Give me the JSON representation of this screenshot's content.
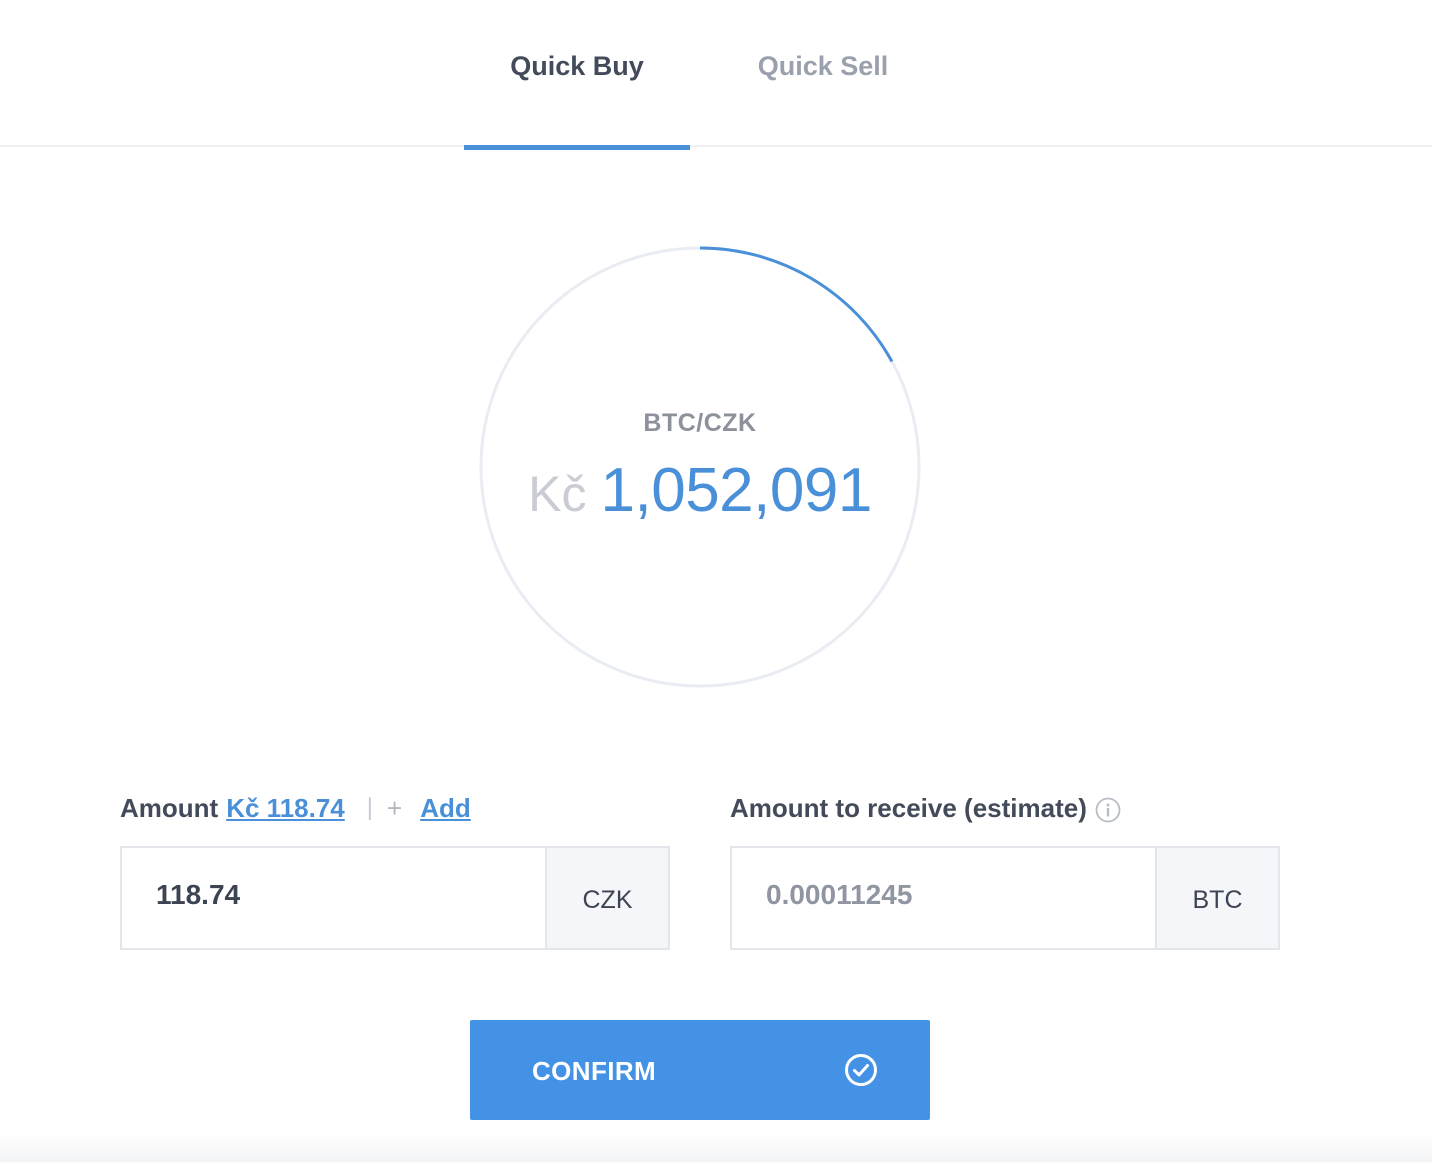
{
  "tabs": [
    {
      "label": "Quick Buy",
      "active": true
    },
    {
      "label": "Quick Sell",
      "active": false
    }
  ],
  "ticker": {
    "pair": "BTC/CZK",
    "currency_symbol": "Kč",
    "price": "1,052,091",
    "progress_fraction": 0.17
  },
  "amount": {
    "label": "Amount",
    "balance_link": "Kč 118.74",
    "separator": "|",
    "plus": "+",
    "add_label": "Add",
    "value": "118.74",
    "unit": "CZK"
  },
  "receive": {
    "label": "Amount to receive (estimate)",
    "info_icon": "info-circle-icon",
    "value": "0.00011245",
    "unit": "BTC"
  },
  "confirm": {
    "label": "CONFIRM",
    "icon": "check-circle-icon"
  },
  "colors": {
    "accent": "#4a90d9",
    "button": "#4392e5",
    "tab_inactive": "#9aa0ad",
    "text_dark": "#434a5a"
  }
}
